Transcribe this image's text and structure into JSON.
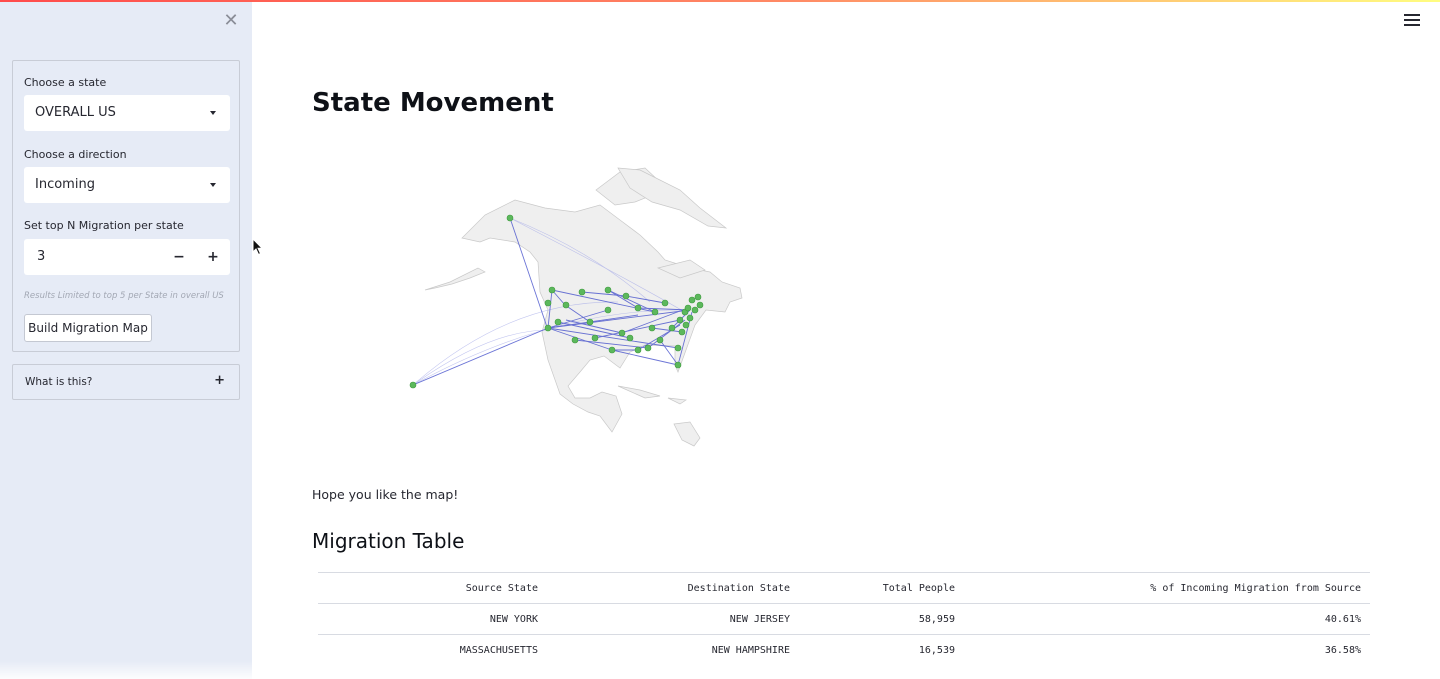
{
  "sidebar": {
    "close_icon": "close-icon",
    "state_label": "Choose a state",
    "state_value": "OVERALL US",
    "direction_label": "Choose a direction",
    "direction_value": "Incoming",
    "topn_label": "Set top N Migration per state",
    "topn_value": "3",
    "minus": "−",
    "plus": "+",
    "help_text": "Results Limited to top 5 per State in overall US",
    "build_button": "Build Migration Map",
    "expander_label": "What is this?",
    "expander_icon": "+"
  },
  "main": {
    "title": "State Movement",
    "map_caption": "Hope you like the map!",
    "table_title": "Migration Table",
    "table": {
      "headers": [
        "Source State",
        "Destination State",
        "Total People",
        "% of Incoming Migration from Source"
      ],
      "rows": [
        [
          "NEW YORK",
          "NEW JERSEY",
          "58,959",
          "40.61%"
        ],
        [
          "MASSACHUSETTS",
          "NEW HAMPSHIRE",
          "16,539",
          "36.58%"
        ]
      ]
    }
  },
  "colors": {
    "sidebar_bg": "#e6ebf6",
    "node": "#5cb85c",
    "edge": "#3b47c9",
    "land": "#efefef"
  }
}
